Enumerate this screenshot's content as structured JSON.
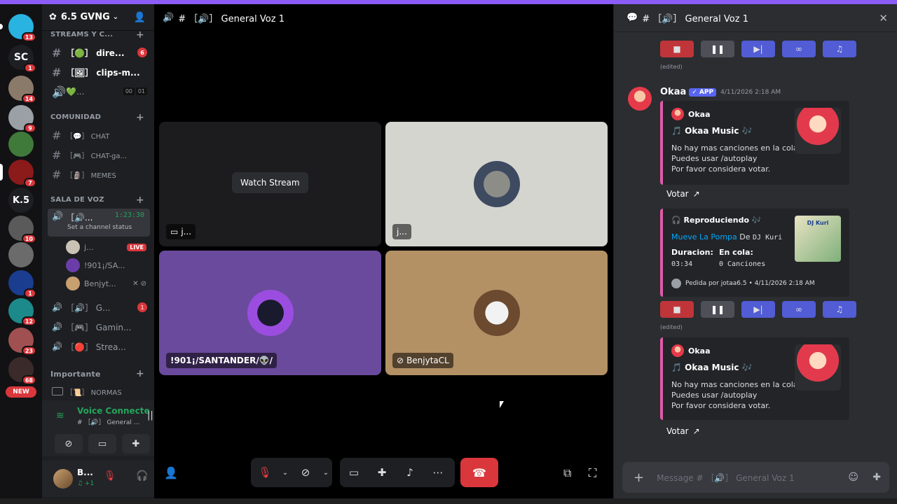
{
  "guild": {
    "name": "6.5 GVNG"
  },
  "server_badges": [
    "13",
    "1",
    "14",
    "9",
    "",
    "7",
    "",
    "10",
    "",
    "1",
    "12",
    "23",
    "68"
  ],
  "server_text": {
    "sc": "SC",
    "k5": "K.5",
    "new": "NEW"
  },
  "sidebar": {
    "cat_streams": "STREAMS Y C...",
    "ch_dire": "［🟢］ dire...",
    "ch_dire_badge": "6",
    "ch_clips": "［🖼］ clips-m...",
    "ch_voice1": "💚...",
    "ch_voice1_counts": [
      "00",
      "01"
    ],
    "cat_comunidad": "COMUNIDAD",
    "ch_chat": "［💬］ CHAT",
    "ch_chatga": "［🎮］ CHAT-ga...",
    "ch_memes": "［🗿］ MEMES",
    "cat_voz": "SALA DE VOZ",
    "ch_active": "［🔊...",
    "ch_active_timer": "1:23:30",
    "ch_active_status": "Set a channel status",
    "vusers": [
      {
        "name": "j...",
        "badge": "LIVE"
      },
      {
        "name": "!901¡/SA..."
      },
      {
        "name": "Benjyt..."
      }
    ],
    "ch_g": "［🔊］ G...",
    "ch_g_badge": "1",
    "ch_gaming": "［🎮］ Gamin...",
    "ch_strea": "［🔴］ Strea...",
    "cat_importante": "Importante",
    "ch_normas": "［📜］ NORMAS"
  },
  "voice_panel": {
    "title": "Voice Connecte",
    "sub": "# ［🔊］ General ..."
  },
  "user_panel": {
    "name": "B...",
    "sub": "♫ +1"
  },
  "stage": {
    "title": "# ［🔊］ General Voz 1",
    "watch_stream": "Watch Stream",
    "tiles": [
      {
        "label": "j..."
      },
      {
        "label": "j..."
      },
      {
        "label": "!901¡/SANTANDER/👽/"
      },
      {
        "label": "BenjytaCL"
      }
    ]
  },
  "chat": {
    "title": "# ［🔊］ General Voz 1",
    "edited": "(edited)",
    "author": "Okaa",
    "app_tag": "✓ APP",
    "timestamp": "4/11/2026 2:18 AM",
    "embed_author": "Okaa",
    "embed_title": "🎵 Okaa Music 🎶",
    "embed_desc": "No hay mas canciones en la cola.\nPuedes usar /autoplay\nPor favor considera votar.",
    "votar": "Votar",
    "np_title": "🎧 Reproduciendo 🎶",
    "np_song": "Mueve La Pompa",
    "np_de": "De",
    "np_artist": "DJ Kuri",
    "np_dur_label": "Duracion:",
    "np_dur": "03:34",
    "np_queue_label": "En cola:",
    "np_queue": "0 Canciones",
    "np_footer": "Pedida por jotaa6.5 • 4/11/2026 2:18 AM",
    "thumb_text": "DJ Kuri",
    "input_placeholder": "Message # ［🔊］ General Voz 1"
  },
  "colors": {
    "accent": "#5865f2",
    "danger": "#da373c",
    "online": "#23a55a",
    "tile_purple": "#6a4a9c",
    "tile_tan": "#b39165",
    "tile_gray": "#d5d5d0"
  }
}
